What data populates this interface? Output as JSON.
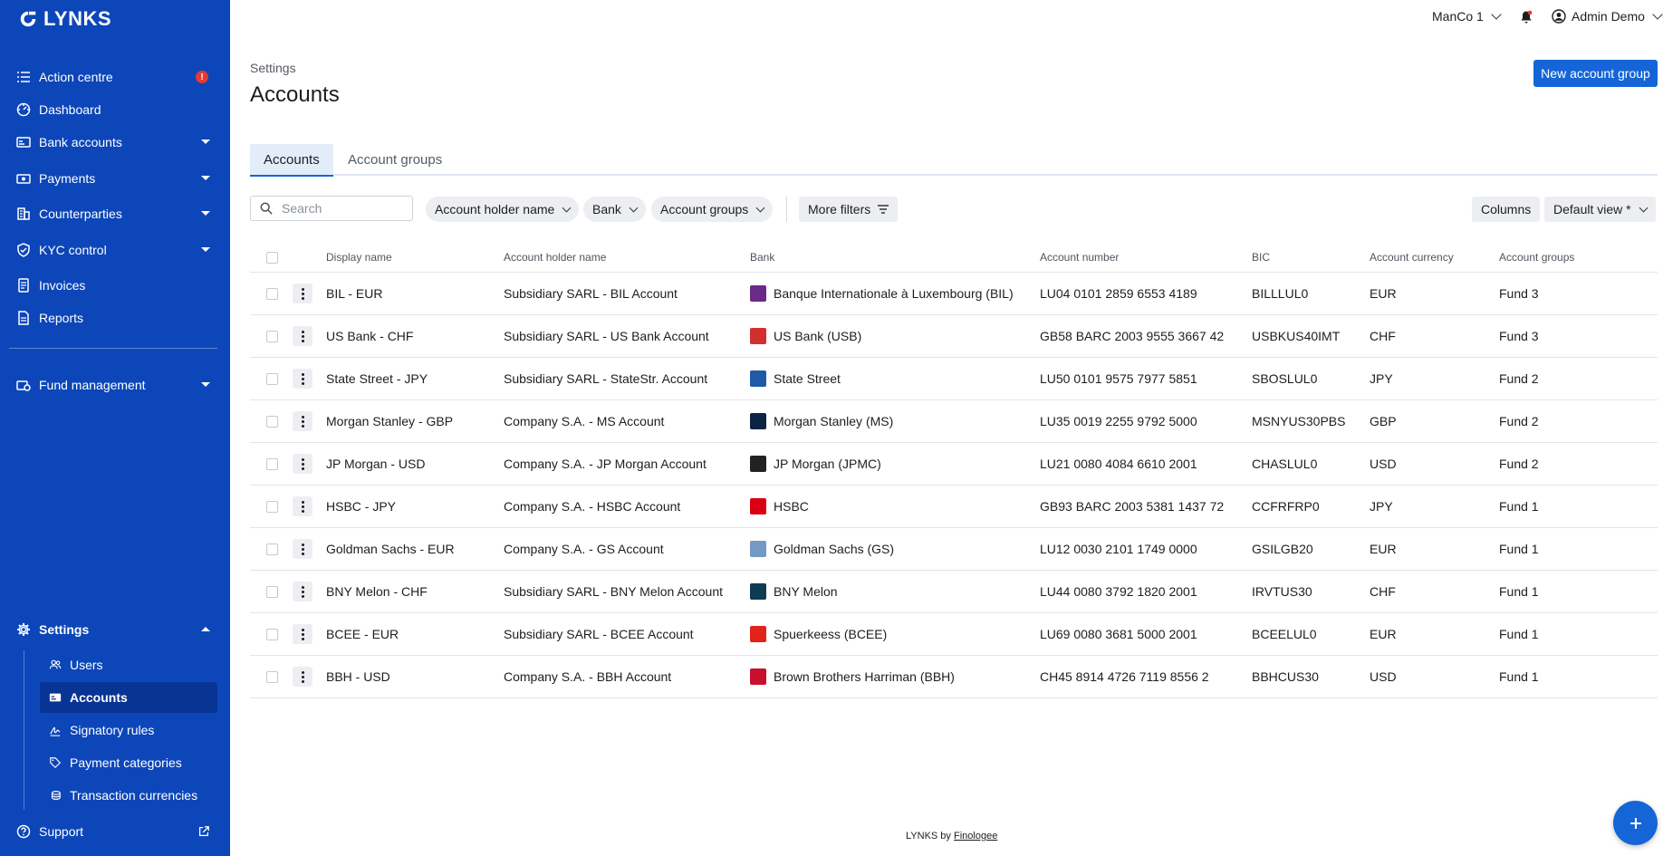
{
  "app": {
    "name": "LYNKS"
  },
  "sidebar": {
    "items": [
      {
        "label": "Action centre",
        "icon": "list-check-icon",
        "badge": "!"
      },
      {
        "label": "Dashboard",
        "icon": "dashboard-icon"
      },
      {
        "label": "Bank accounts",
        "icon": "bank-card-icon"
      },
      {
        "label": "Payments",
        "icon": "payment-icon"
      },
      {
        "label": "Counterparties",
        "icon": "building-icon"
      },
      {
        "label": "KYC control",
        "icon": "shield-check-icon"
      },
      {
        "label": "Invoices",
        "icon": "invoice-icon"
      },
      {
        "label": "Reports",
        "icon": "report-icon"
      },
      {
        "label": "Fund management",
        "icon": "fund-icon"
      },
      {
        "label": "Settings",
        "icon": "gear-icon"
      }
    ],
    "settings_sub": [
      {
        "label": "Users",
        "icon": "users-icon"
      },
      {
        "label": "Accounts",
        "icon": "account-card-icon"
      },
      {
        "label": "Signatory rules",
        "icon": "signature-icon"
      },
      {
        "label": "Payment categories",
        "icon": "tag-icon"
      },
      {
        "label": "Transaction currencies",
        "icon": "coins-icon"
      }
    ],
    "support": "Support"
  },
  "topbar": {
    "entity": "ManCo 1",
    "user": "Admin Demo"
  },
  "page": {
    "breadcrumb": "Settings",
    "title": "Accounts",
    "new_button": "New account group"
  },
  "tabs": [
    {
      "label": "Accounts"
    },
    {
      "label": "Account groups"
    }
  ],
  "filters": {
    "search_placeholder": "Search",
    "account_holder": "Account holder name",
    "bank": "Bank",
    "account_groups": "Account groups",
    "more_filters": "More filters",
    "columns": "Columns",
    "view": "Default view *"
  },
  "table": {
    "headers": {
      "display_name": "Display name",
      "holder": "Account holder name",
      "bank": "Bank",
      "number": "Account number",
      "bic": "BIC",
      "currency": "Account currency",
      "groups": "Account groups"
    },
    "rows": [
      {
        "display_name": "BIL - EUR",
        "holder": "Subsidiary SARL - BIL Account",
        "bank": "Banque Internationale à Luxembourg (BIL)",
        "number": "LU04 0101 2859 6553 4189",
        "bic": "BILLLUL0",
        "currency": "EUR",
        "groups": "Fund 3",
        "logo_color": "#6b2a8a"
      },
      {
        "display_name": "US Bank - CHF",
        "holder": "Subsidiary SARL - US Bank Account",
        "bank": "US Bank (USB)",
        "number": "GB58 BARC 2003 9555 3667 42",
        "bic": "USBKUS40IMT",
        "currency": "CHF",
        "groups": "Fund 3",
        "logo_color": "#d32f2f"
      },
      {
        "display_name": "State Street - JPY",
        "holder": "Subsidiary SARL - StateStr. Account",
        "bank": "State Street",
        "number": "LU50 0101 9575 7977 5851",
        "bic": "SBOSLUL0",
        "currency": "JPY",
        "groups": "Fund 2",
        "logo_color": "#1e5aa8"
      },
      {
        "display_name": "Morgan Stanley - GBP",
        "holder": "Company S.A. - MS Account",
        "bank": "Morgan Stanley (MS)",
        "number": "LU35 0019 2255 9792 5000",
        "bic": "MSNYUS30PBS",
        "currency": "GBP",
        "groups": "Fund 2",
        "logo_color": "#0b2344"
      },
      {
        "display_name": "JP Morgan - USD",
        "holder": "Company S.A. - JP Morgan Account",
        "bank": "JP Morgan (JPMC)",
        "number": "LU21 0080 4084 6610 2001",
        "bic": "CHASLUL0",
        "currency": "USD",
        "groups": "Fund 2",
        "logo_color": "#222222"
      },
      {
        "display_name": "HSBC - JPY",
        "holder": "Company S.A. - HSBC Account",
        "bank": "HSBC",
        "number": "GB93 BARC 2003 5381 1437 72",
        "bic": "CCFRFRP0",
        "currency": "JPY",
        "groups": "Fund 1",
        "logo_color": "#db0011"
      },
      {
        "display_name": "Goldman Sachs - EUR",
        "holder": "Company S.A. - GS Account",
        "bank": "Goldman Sachs (GS)",
        "number": "LU12 0030 2101 1749 0000",
        "bic": "GSILGB20",
        "currency": "EUR",
        "groups": "Fund 1",
        "logo_color": "#7399c6"
      },
      {
        "display_name": "BNY Melon - CHF",
        "holder": "Subsidiary SARL - BNY Melon Account",
        "bank": "BNY Melon",
        "number": "LU44 0080 3792 1820 2001",
        "bic": "IRVTUS30",
        "currency": "CHF",
        "groups": "Fund 1",
        "logo_color": "#0e3b52"
      },
      {
        "display_name": "BCEE - EUR",
        "holder": "Subsidiary SARL - BCEE Account",
        "bank": "Spuerkeess (BCEE)",
        "number": "LU69 0080 3681 5000 2001",
        "bic": "BCEELUL0",
        "currency": "EUR",
        "groups": "Fund 1",
        "logo_color": "#e2231a"
      },
      {
        "display_name": "BBH - USD",
        "holder": "Company S.A. - BBH Account",
        "bank": "Brown Brothers Harriman (BBH)",
        "number": "CH45 8914 4726 7119 8556 2",
        "bic": "BBHCUS30",
        "currency": "USD",
        "groups": "Fund 1",
        "logo_color": "#c8102e"
      }
    ]
  },
  "footer": {
    "prefix": "LYNKS by",
    "link": "Finologee"
  },
  "colors": {
    "sidebar": "#0c46b9",
    "sidebar_active": "#083493",
    "primary": "#1565d8",
    "alert": "#e53935"
  }
}
